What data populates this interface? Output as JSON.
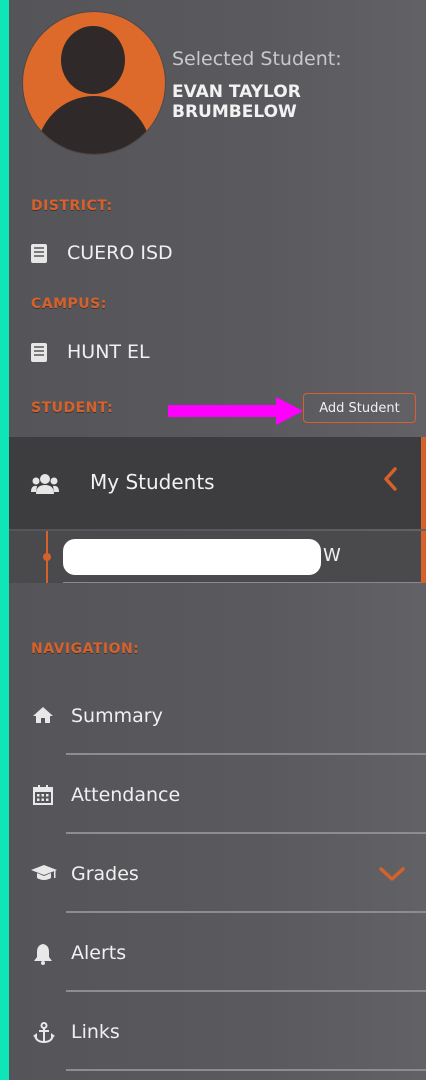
{
  "selected": {
    "caption": "Selected Student:",
    "name": "EVAN TAYLOR BRUMBELOW"
  },
  "district": {
    "heading": "DISTRICT:",
    "name": "CUERO ISD",
    "icon": "building-icon"
  },
  "campus": {
    "heading": "CAMPUS:",
    "name": "HUNT EL",
    "icon": "building-icon"
  },
  "student_section": {
    "heading": "STUDENT:",
    "add_label": "Add Student",
    "annotation_arrow_color": "#ff00ff"
  },
  "my_students": {
    "label": "My Students",
    "icon": "users-icon",
    "toggle_icon": "chevron-left-icon"
  },
  "student_row": {
    "name_visible": "W"
  },
  "navigation": {
    "heading": "NAVIGATION:",
    "items": [
      {
        "label": "Summary",
        "icon": "home-icon"
      },
      {
        "label": "Attendance",
        "icon": "calendar-icon"
      },
      {
        "label": "Grades",
        "icon": "graduation-cap-icon",
        "toggle_icon": "chevron-down-icon"
      },
      {
        "label": "Alerts",
        "icon": "bell-icon"
      },
      {
        "label": "Links",
        "icon": "anchor-icon"
      }
    ]
  },
  "colors": {
    "accent": "#d7612a",
    "left_edge": "#0fe6b8",
    "panel": "#58585c",
    "avatar_bg": "#dd6a2a"
  }
}
